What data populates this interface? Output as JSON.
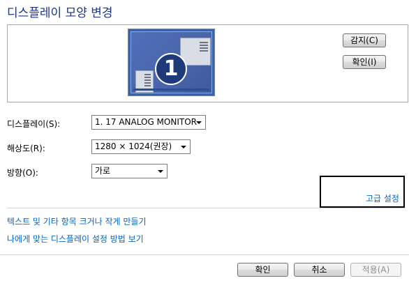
{
  "window": {
    "title": "디스플레이 모양 변경"
  },
  "preview": {
    "monitor_number": "1"
  },
  "buttons": {
    "detect": "감지(C)",
    "identify": "확인(I)"
  },
  "settings": {
    "display_label": "디스플레이(S):",
    "display_value": "1. 17 ANALOG MONITOR",
    "resolution_label": "해상도(R):",
    "resolution_value": "1280 × 1024(권장)",
    "orientation_label": "방향(O):",
    "orientation_value": "가로"
  },
  "links": {
    "advanced": "고급 설정",
    "text_size": "텍스트 및 기타 항목 크거나 작게 만들기",
    "display_help": "나에게 맞는 디스플레이 설정 방법 보기"
  },
  "footer": {
    "ok": "확인",
    "cancel": "취소",
    "apply": "적용(A)"
  }
}
